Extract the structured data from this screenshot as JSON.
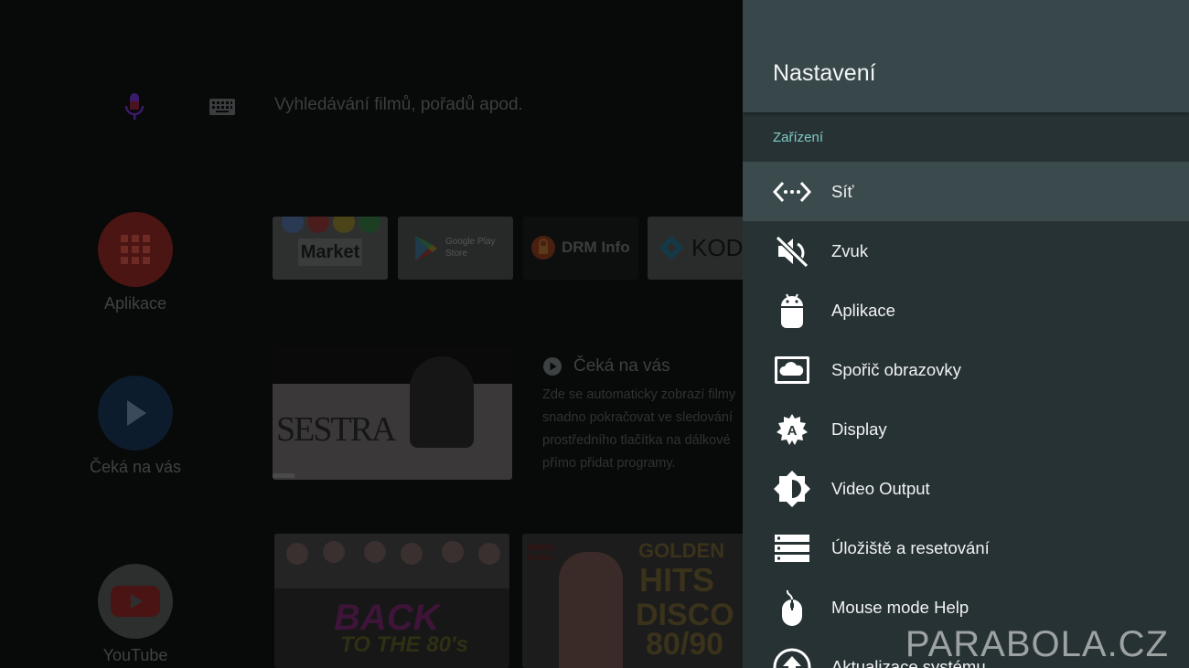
{
  "search": {
    "placeholder": "Vyhledávání filmů, pořadů apod."
  },
  "rail": [
    {
      "label": "Aplikace",
      "icon": "apps-grid-icon",
      "color": "#4a1512"
    },
    {
      "label": "Čeká na vás",
      "icon": "play-icon",
      "color": "#0d1c2c"
    },
    {
      "label": "YouTube",
      "icon": "youtube-icon",
      "color": "#2d2f2f"
    }
  ],
  "apps": [
    {
      "name": "Market"
    },
    {
      "name": "Google Play",
      "sub": "Store"
    },
    {
      "name": "DRM Info"
    },
    {
      "name": "KODI"
    }
  ],
  "watch_next": {
    "title": "Čeká na vás",
    "card_title": "SESTRA",
    "description": [
      "Zde se automaticky zobrazí filmy",
      "snadno pokračovat ve sledování",
      "prostředního tlačítka na dálkové",
      "přímo přidat programy."
    ]
  },
  "youtube_cards": [
    {
      "line1": "BACK",
      "line2": "TO THE 80's"
    },
    {
      "badge": "DISCO MUSIC",
      "line1": "GOLDEN",
      "line2": "HITS",
      "line3": "DISCO",
      "line4": "80/90"
    }
  ],
  "settings": {
    "title": "Nastavení",
    "section": "Zařízení",
    "items": [
      {
        "label": "Síť",
        "icon": "network-icon",
        "selected": true
      },
      {
        "label": "Zvuk",
        "icon": "sound-off-icon"
      },
      {
        "label": "Aplikace",
        "icon": "android-icon"
      },
      {
        "label": "Spořič obrazovky",
        "icon": "screensaver-icon"
      },
      {
        "label": "Display",
        "icon": "display-icon"
      },
      {
        "label": "Video Output",
        "icon": "brightness-icon"
      },
      {
        "label": "Úložiště a resetování",
        "icon": "storage-icon"
      },
      {
        "label": "Mouse mode Help",
        "icon": "mouse-icon"
      },
      {
        "label": "Aktualizace systému",
        "icon": "system-update-icon"
      }
    ]
  },
  "watermark": "PARABOLA.CZ",
  "colors": {
    "panel": "#273234",
    "header": "#37474a",
    "accent": "#7fcbc4",
    "selected": "#3b4a4d"
  }
}
